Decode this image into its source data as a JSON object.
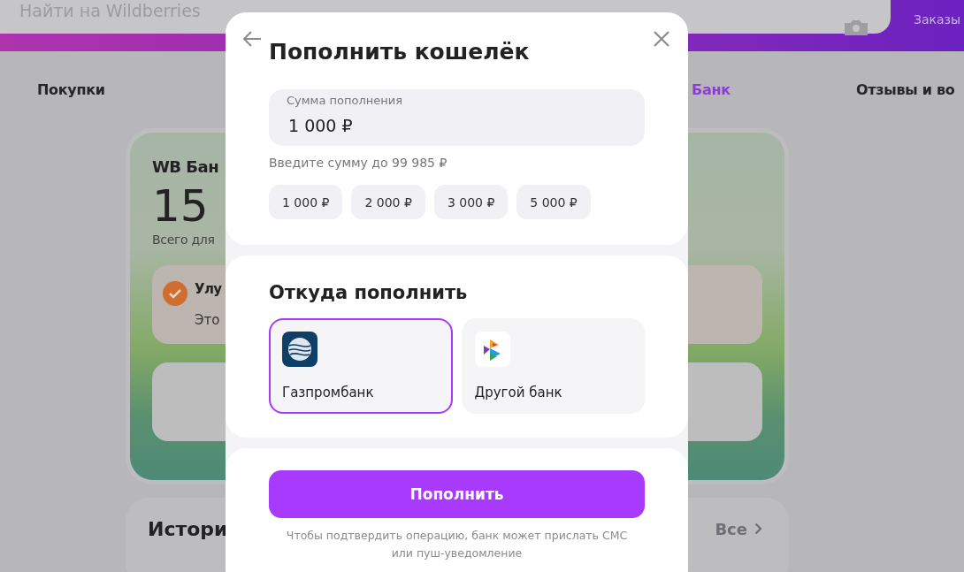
{
  "header": {
    "search": {
      "placeholder": "Найти на Wildberries"
    },
    "orders_link": "Заказы"
  },
  "nav": [
    {
      "label": "Покупки",
      "selected": false
    },
    {
      "label": "Банк",
      "selected": true
    },
    {
      "label": "Отзывы и во",
      "selected": false
    }
  ],
  "wallet_card": {
    "title": "WB Бан",
    "balance": "15",
    "subtitle": "Всего для",
    "notice": {
      "title": "Улу",
      "text": "Это",
      "checked": true
    }
  },
  "history": {
    "title": "Истори",
    "all_link": "Все"
  },
  "modal": {
    "title": "Пополнить кошелёк",
    "amount": {
      "label": "Сумма пополнения",
      "value": "1 000 ₽"
    },
    "hint": "Введите сумму до 99 985 ₽",
    "presets": [
      "1 000 ₽",
      "2 000 ₽",
      "3 000 ₽",
      "5 000 ₽"
    ],
    "source_title": "Откуда пополнить",
    "sources": [
      {
        "name": "Газпромбанк",
        "kind": "gazprom",
        "selected": true
      },
      {
        "name": "Другой банк",
        "kind": "sbp",
        "selected": false
      }
    ],
    "submit": "Пополнить",
    "note": "Чтобы подтвердить операцию, банк может прислать СМС или пуш-уведомление"
  }
}
